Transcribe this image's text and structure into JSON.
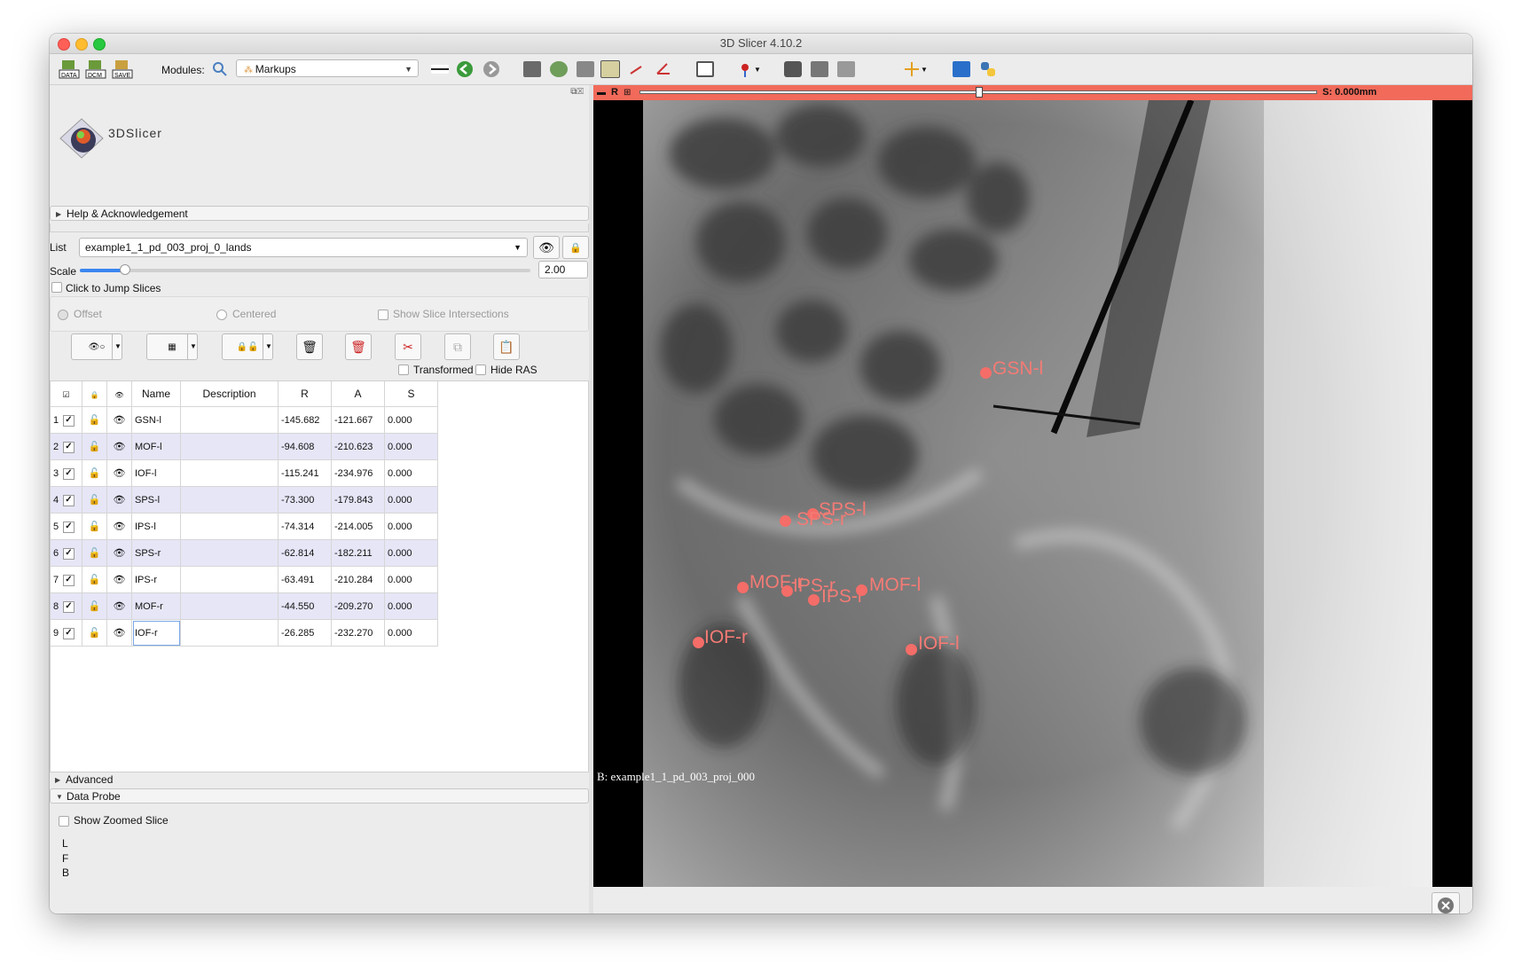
{
  "window": {
    "title": "3D Slicer 4.10.2"
  },
  "toolbar": {
    "data_label": "DATA",
    "dcm_label": "DCM",
    "save_label": "SAVE",
    "modules_label": "Modules:",
    "module_selected": "Markups"
  },
  "logo": {
    "text": "3DSlicer"
  },
  "sections": {
    "help": "Help & Acknowledgement",
    "advanced": "Advanced",
    "data_probe": "Data Probe"
  },
  "markups": {
    "list_label": "List",
    "list_value": "example1_1_pd_003_proj_0_lands",
    "scale_label": "Scale",
    "scale_value": "2.00",
    "scale_fraction": 0.1,
    "jump_slices": "Click to Jump Slices",
    "offset": "Offset",
    "centered": "Centered",
    "show_intersections": "Show Slice Intersections",
    "transformed": "Transformed",
    "hide_ras": "Hide RAS"
  },
  "table": {
    "headers": [
      "Name",
      "Description",
      "R",
      "A",
      "S"
    ],
    "rows": [
      {
        "n": "1",
        "name": "GSN-l",
        "r": "-145.682",
        "a": "-121.667",
        "s": "0.000"
      },
      {
        "n": "2",
        "name": "MOF-l",
        "r": "-94.608",
        "a": "-210.623",
        "s": "0.000"
      },
      {
        "n": "3",
        "name": "IOF-l",
        "r": "-115.241",
        "a": "-234.976",
        "s": "0.000"
      },
      {
        "n": "4",
        "name": "SPS-l",
        "r": "-73.300",
        "a": "-179.843",
        "s": "0.000"
      },
      {
        "n": "5",
        "name": "IPS-l",
        "r": "-74.314",
        "a": "-214.005",
        "s": "0.000"
      },
      {
        "n": "6",
        "name": "SPS-r",
        "r": "-62.814",
        "a": "-182.211",
        "s": "0.000"
      },
      {
        "n": "7",
        "name": "IPS-r",
        "r": "-63.491",
        "a": "-210.284",
        "s": "0.000"
      },
      {
        "n": "8",
        "name": "MOF-r",
        "r": "-44.550",
        "a": "-209.270",
        "s": "0.000"
      },
      {
        "n": "9",
        "name": "IOF-r",
        "r": "-26.285",
        "a": "-232.270",
        "s": "0.000"
      }
    ]
  },
  "probe": {
    "show_zoomed": "Show Zoomed Slice",
    "l": "L",
    "f": "F",
    "b": "B"
  },
  "slice": {
    "r_label": "R",
    "offset": "S: 0.000mm",
    "slider_fraction": 0.5,
    "background": "B: example1_1_pd_003_proj_000",
    "bar_color": "#f16a5a",
    "landmark_color": "#f46d68"
  },
  "landmarks": [
    {
      "label": "GSN-l"
    },
    {
      "label": "SPS-l"
    },
    {
      "label": "SPS-r"
    },
    {
      "label": "MOF-r"
    },
    {
      "label": "IPS-r"
    },
    {
      "label": "IPS-l"
    },
    {
      "label": "MOF-l"
    },
    {
      "label": "IOF-r"
    },
    {
      "label": "IOF-l"
    }
  ]
}
